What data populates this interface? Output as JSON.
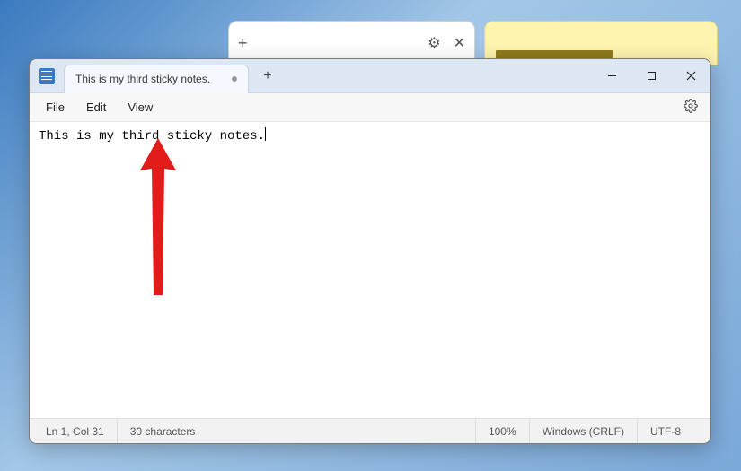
{
  "background": {
    "sticky_plus": "+",
    "sticky_gear": "⚙",
    "sticky_close": "✕"
  },
  "notepad": {
    "tab_title": "This is my third sticky notes.",
    "new_tab": "+",
    "menu": {
      "file": "File",
      "edit": "Edit",
      "view": "View"
    },
    "content": "This is my third sticky notes.",
    "status": {
      "position": "Ln 1, Col 31",
      "chars": "30 characters",
      "zoom": "100%",
      "eol": "Windows (CRLF)",
      "encoding": "UTF-8"
    }
  }
}
